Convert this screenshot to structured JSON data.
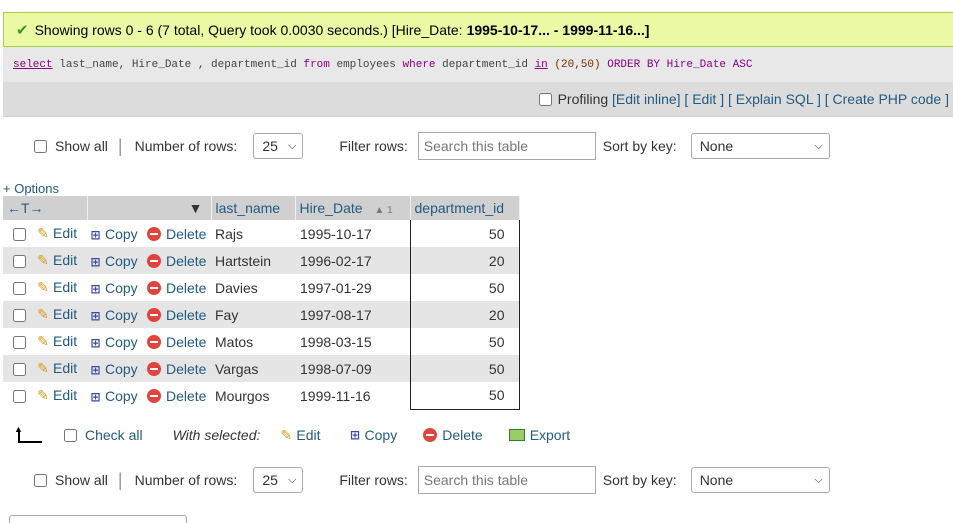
{
  "success": {
    "text": "Showing rows 0 - 6 (7 total, Query took 0.0030 seconds.) [Hire_Date:",
    "range": "1995-10-17... - 1999-11-16...]"
  },
  "sql": {
    "select": "select",
    "cols": "last_name, Hire_Date , department_id",
    "from": "from",
    "table": "employees",
    "where": "where",
    "col": "department_id",
    "in": "in",
    "list": "(20,50)",
    "order": "ORDER BY Hire_Date ASC"
  },
  "tools": {
    "profiling": "Profiling",
    "edit_inline": "[Edit inline]",
    "edit": "[ Edit ]",
    "explain": "[ Explain SQL ]",
    "create_php": "[ Create PHP code ]"
  },
  "nav": {
    "show_all": "Show all",
    "num_rows_label": "Number of rows:",
    "num_rows_value": "25",
    "filter_label": "Filter rows:",
    "filter_placeholder": "Search this table",
    "sort_label": "Sort by key:",
    "sort_value": "None"
  },
  "options_link": "+ Options",
  "table": {
    "arrows": "←T→",
    "columns": [
      "last_name",
      "Hire_Date",
      "department_id"
    ],
    "sort_indicator": "▲ 1",
    "edit": "Edit",
    "copy": "Copy",
    "delete": "Delete",
    "rows": [
      {
        "last_name": "Rajs",
        "hire_date": "1995-10-17",
        "department_id": "50"
      },
      {
        "last_name": "Hartstein",
        "hire_date": "1996-02-17",
        "department_id": "20"
      },
      {
        "last_name": "Davies",
        "hire_date": "1997-01-29",
        "department_id": "50"
      },
      {
        "last_name": "Fay",
        "hire_date": "1997-08-17",
        "department_id": "20"
      },
      {
        "last_name": "Matos",
        "hire_date": "1998-03-15",
        "department_id": "50"
      },
      {
        "last_name": "Vargas",
        "hire_date": "1998-07-09",
        "department_id": "50"
      },
      {
        "last_name": "Mourgos",
        "hire_date": "1999-11-16",
        "department_id": "50"
      }
    ]
  },
  "with_selected": {
    "check_all": "Check all",
    "label": "With selected:",
    "edit": "Edit",
    "copy": "Copy",
    "delete": "Delete",
    "export": "Export"
  },
  "colors": {
    "link": "#235a81",
    "success_bg": "#ebf8a4",
    "row_alt": "#e5e5e5"
  }
}
